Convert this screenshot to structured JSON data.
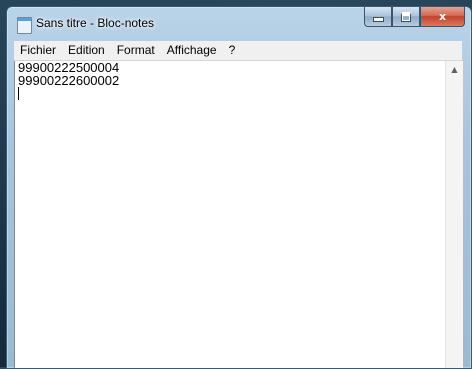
{
  "window": {
    "title": "Sans titre - Bloc-notes",
    "app_icon": "notepad-icon",
    "controls": {
      "minimize_icon": "minimize-icon",
      "maximize_icon": "maximize-icon",
      "close_glyph": "x"
    }
  },
  "menu": {
    "items": [
      "Fichier",
      "Edition",
      "Format",
      "Affichage",
      "?"
    ]
  },
  "editor": {
    "lines": [
      "99900222500004",
      "99900222600002"
    ]
  },
  "scrollbar": {
    "up_glyph": "▲"
  },
  "colors": {
    "close_button": "#c1432a",
    "titlebar": "#a6c4de",
    "menubar": "#f0f0f0"
  }
}
